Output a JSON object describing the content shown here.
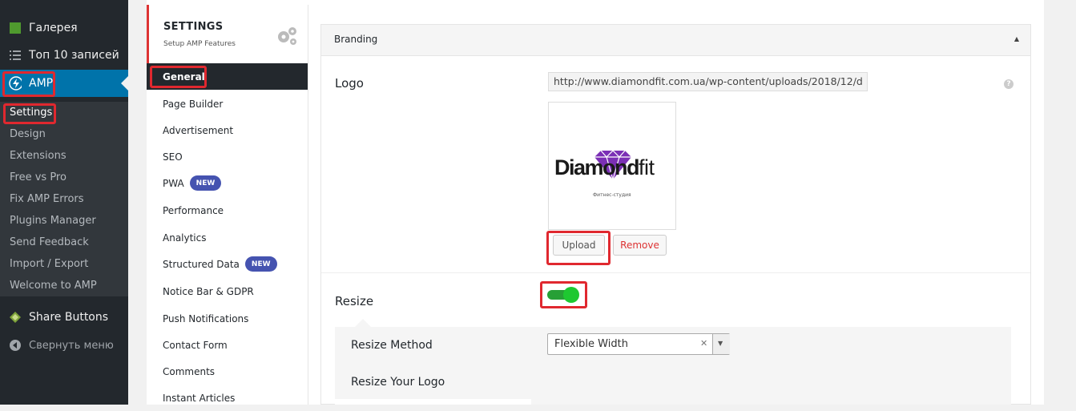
{
  "wp_menu": {
    "items": [
      {
        "label": "Галерея",
        "icon": "gallery-icon"
      },
      {
        "label": "Топ 10 записей",
        "icon": "list-icon"
      },
      {
        "label": "AMP",
        "icon": "amp-bolt-icon"
      }
    ],
    "amp_submenu": [
      "Settings",
      "Design",
      "Extensions",
      "Free vs Pro",
      "Fix AMP Errors",
      "Plugins Manager",
      "Send Feedback",
      "Import / Export",
      "Welcome to AMP"
    ],
    "share_buttons": "Share Buttons",
    "collapse": "Свернуть меню"
  },
  "redux": {
    "title": "SETTINGS",
    "subtitle": "Setup AMP Features",
    "active": "General",
    "items": [
      {
        "label": "Page Builder",
        "badge": ""
      },
      {
        "label": "Advertisement",
        "badge": ""
      },
      {
        "label": "SEO",
        "badge": ""
      },
      {
        "label": "PWA",
        "badge": "NEW"
      },
      {
        "label": "Performance",
        "badge": ""
      },
      {
        "label": "Analytics",
        "badge": ""
      },
      {
        "label": "Structured Data",
        "badge": "NEW"
      },
      {
        "label": "Notice Bar & GDPR",
        "badge": ""
      },
      {
        "label": "Push Notifications",
        "badge": ""
      },
      {
        "label": "Contact Form",
        "badge": ""
      },
      {
        "label": "Comments",
        "badge": ""
      },
      {
        "label": "Instant Articles",
        "badge": ""
      }
    ]
  },
  "branding": {
    "section_title": "Branding",
    "logo_label": "Logo",
    "logo_url": "http://www.diamondfit.com.ua/wp-content/uploads/2018/12/d",
    "help": "?",
    "logo_image": {
      "word": "Diamond",
      "word2": "fit",
      "tagline": "Фитнес-студия"
    },
    "upload_label": "Upload",
    "remove_label": "Remove",
    "resize_label": "Resize",
    "resize_enabled": true,
    "resize_method_label": "Resize Method",
    "resize_method_value": "Flexible Width",
    "resize_logo_label": "Resize Your Logo"
  },
  "colors": {
    "wp_sidebar": "#23282d",
    "wp_active": "#0073aa",
    "accent_red": "#e0282f",
    "badge_blue": "#4553b0",
    "toggle_green": "#1ec831",
    "logo_purple": "#7b2fb5"
  }
}
